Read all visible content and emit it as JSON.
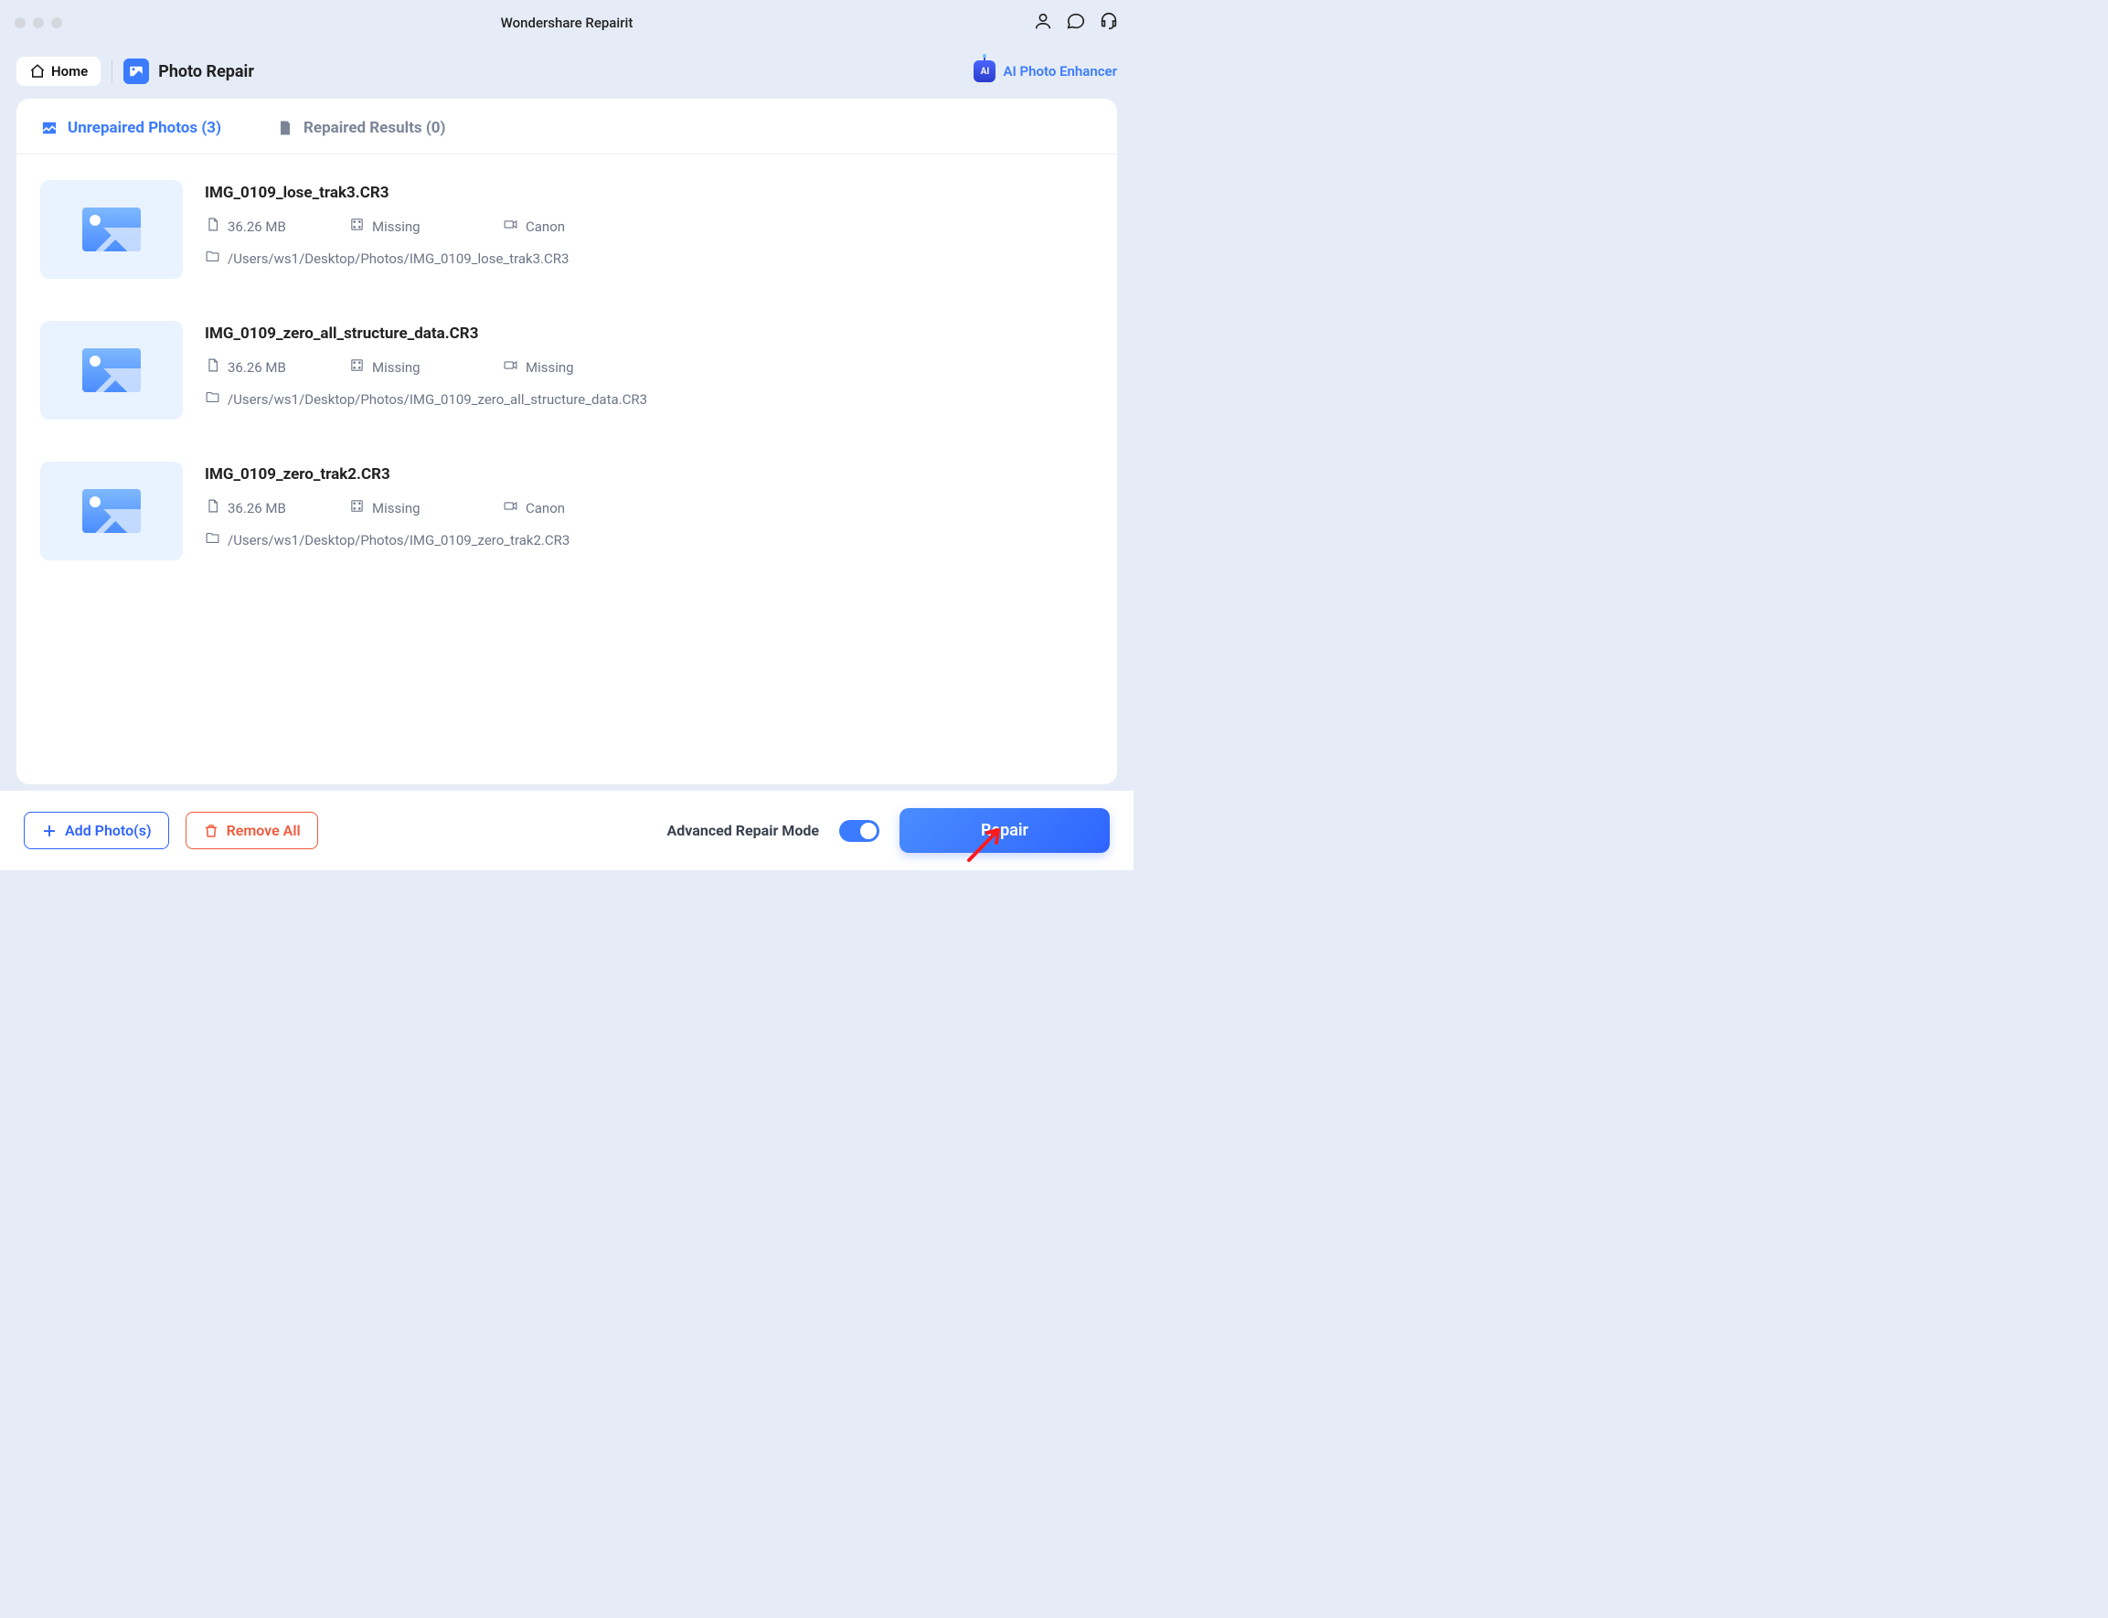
{
  "app_title": "Wondershare Repairit",
  "nav": {
    "home_label": "Home",
    "module_title": "Photo Repair",
    "ai_enhancer_label": "AI Photo Enhancer"
  },
  "tabs": {
    "unrepaired": {
      "label": "Unrepaired Photos",
      "count": 3
    },
    "repaired": {
      "label": "Repaired Results",
      "count": 0
    }
  },
  "files": [
    {
      "name": "IMG_0109_lose_trak3.CR3",
      "size": "36.26 MB",
      "dimensions": "Missing",
      "device": "Canon",
      "path": "/Users/ws1/Desktop/Photos/IMG_0109_lose_trak3.CR3"
    },
    {
      "name": "IMG_0109_zero_all_structure_data.CR3",
      "size": "36.26 MB",
      "dimensions": "Missing",
      "device": "Missing",
      "path": "/Users/ws1/Desktop/Photos/IMG_0109_zero_all_structure_data.CR3"
    },
    {
      "name": "IMG_0109_zero_trak2.CR3",
      "size": "36.26 MB",
      "dimensions": "Missing",
      "device": "Canon",
      "path": "/Users/ws1/Desktop/Photos/IMG_0109_zero_trak2.CR3"
    }
  ],
  "footer": {
    "add_label": "Add Photo(s)",
    "remove_label": "Remove All",
    "advanced_label": "Advanced Repair Mode",
    "repair_label": "Repair",
    "advanced_on": true
  }
}
